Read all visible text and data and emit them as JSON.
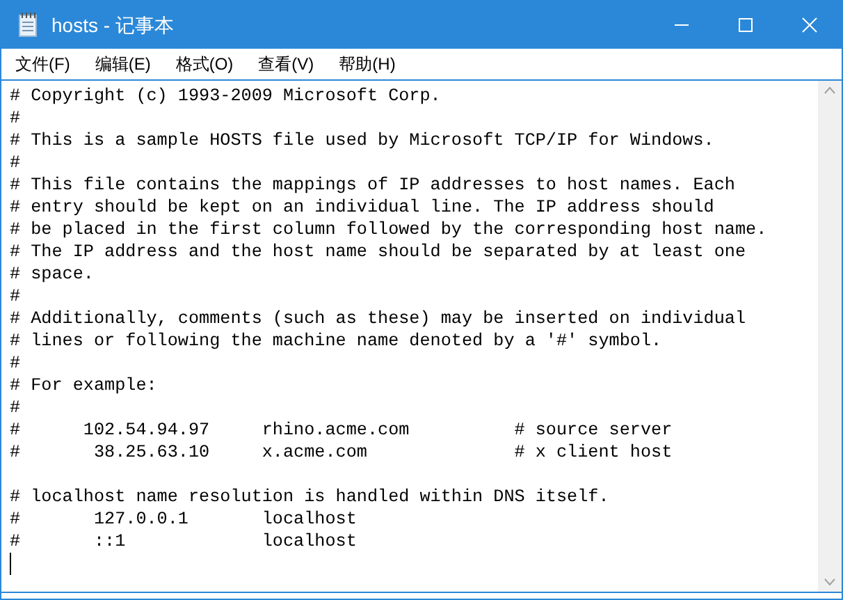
{
  "window": {
    "title": "hosts - 记事本"
  },
  "menu": [
    "文件(F)",
    "编辑(E)",
    "格式(O)",
    "查看(V)",
    "帮助(H)"
  ],
  "editor": {
    "lines": [
      {
        "kind": "text",
        "text": "# Copyright (c) 1993-2009 Microsoft Corp."
      },
      {
        "kind": "text",
        "text": "#"
      },
      {
        "kind": "text",
        "text": "# This is a sample HOSTS file used by Microsoft TCP/IP for Windows."
      },
      {
        "kind": "text",
        "text": "#"
      },
      {
        "kind": "text",
        "text": "# This file contains the mappings of IP addresses to host names. Each"
      },
      {
        "kind": "text",
        "text": "# entry should be kept on an individual line. The IP address should"
      },
      {
        "kind": "text",
        "text": "# be placed in the first column followed by the corresponding host name."
      },
      {
        "kind": "text",
        "text": "# The IP address and the host name should be separated by at least one"
      },
      {
        "kind": "text",
        "text": "# space."
      },
      {
        "kind": "text",
        "text": "#"
      },
      {
        "kind": "text",
        "text": "# Additionally, comments (such as these) may be inserted on individual"
      },
      {
        "kind": "text",
        "text": "# lines or following the machine name denoted by a '#' symbol."
      },
      {
        "kind": "text",
        "text": "#"
      },
      {
        "kind": "text",
        "text": "# For example:"
      },
      {
        "kind": "text",
        "text": "#"
      },
      {
        "kind": "text",
        "text": "#      102.54.94.97     rhino.acme.com          # source server"
      },
      {
        "kind": "text",
        "text": "#       38.25.63.10     x.acme.com              # x client host"
      },
      {
        "kind": "blank"
      },
      {
        "kind": "text",
        "text": "# localhost name resolution is handled within DNS itself."
      },
      {
        "kind": "text",
        "text": "#       127.0.0.1       localhost"
      },
      {
        "kind": "text",
        "text": "#       ::1             localhost"
      },
      {
        "kind": "caret"
      }
    ]
  }
}
